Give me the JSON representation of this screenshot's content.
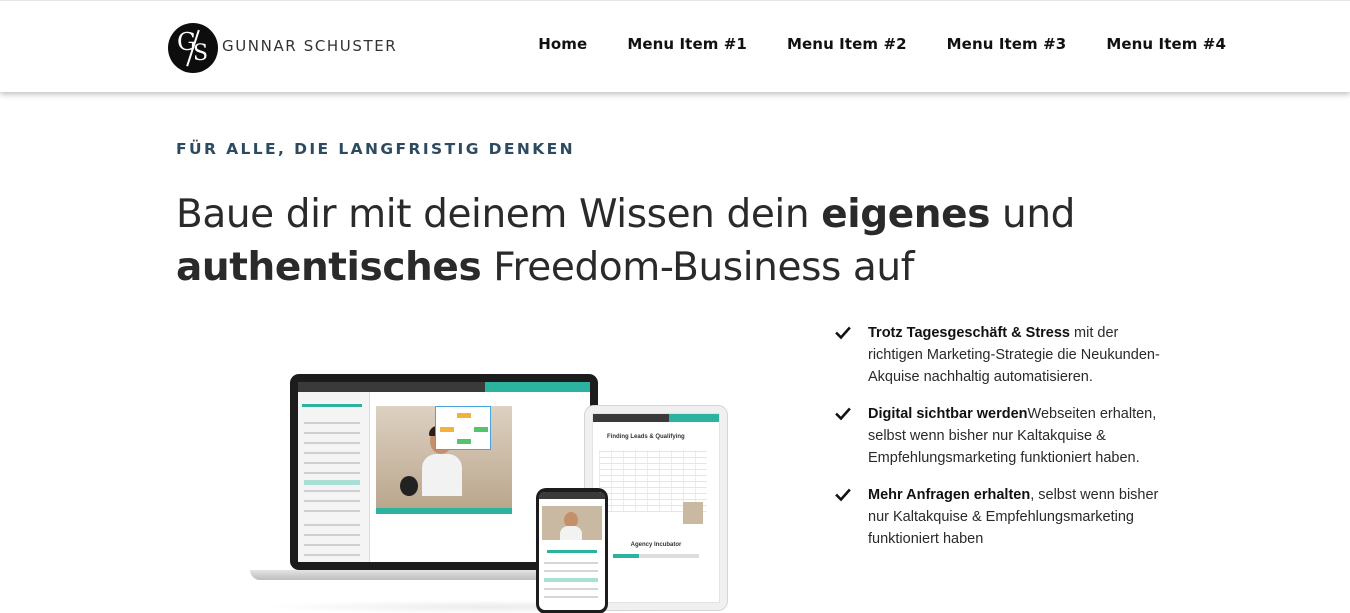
{
  "header": {
    "logo_letters": "G/S",
    "brand_name": "GUNNAR SCHUSTER",
    "nav": [
      "Home",
      "Menu Item #1",
      "Menu Item #2",
      "Menu Item #3",
      "Menu Item #4"
    ]
  },
  "hero": {
    "eyebrow": "FÜR ALLE, DIE LANGFRISTIG DENKEN",
    "headline": {
      "part1": "Baue dir mit deinem Wissen dein ",
      "bold1": "eigenes",
      "part2": " und ",
      "bold2": "authentisches",
      "part3": " Freedom-Business auf"
    }
  },
  "features": [
    {
      "bold": "Trotz Tagesgeschäft & Stress",
      "text": " mit der richtigen Marketing-Strategie die Neukunden-Akquise nachhaltig automatisieren."
    },
    {
      "bold": "Digital sichtbar werden",
      "text": "Webseiten erhalten, selbst wenn bisher nur Kaltakquise & Empfehlungsmarketing funktioniert haben."
    },
    {
      "bold": "Mehr Anfragen erhalten",
      "text": ", selbst wenn bisher nur Kaltakquise & Empfehlungsmarketing funktioniert haben"
    }
  ],
  "mockup": {
    "tablet_title": "Finding Leads & Qualifying",
    "tablet_subtitle": "Agency Incubator",
    "icons": [
      "check-icon",
      "play-icon"
    ]
  },
  "colors": {
    "accent": "#2bb3a0",
    "eyebrow": "#2d4a5f",
    "text": "#2a2a2a"
  }
}
